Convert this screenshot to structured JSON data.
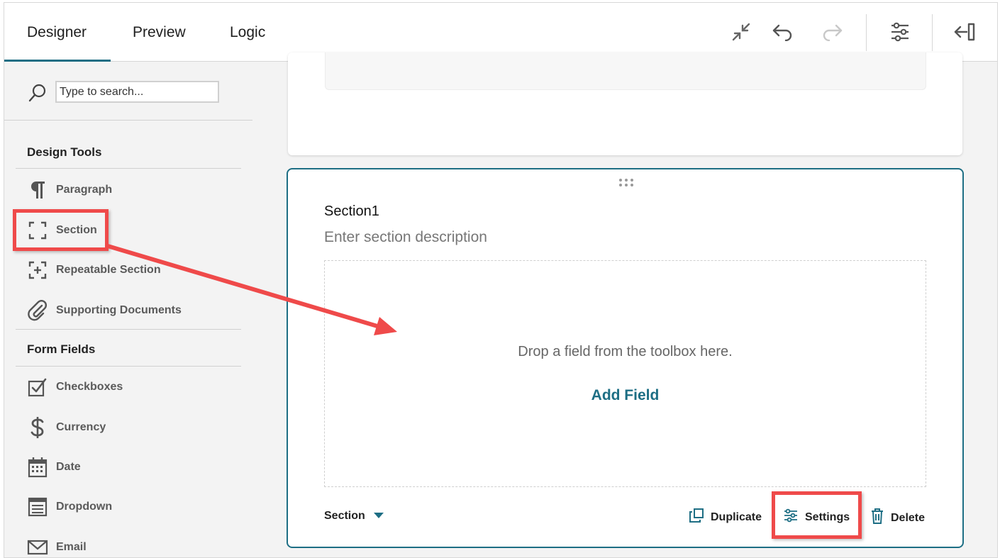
{
  "tabs": [
    {
      "label": "Designer",
      "active": true
    },
    {
      "label": "Preview",
      "active": false
    },
    {
      "label": "Logic",
      "active": false
    }
  ],
  "toolbar": {
    "icons": [
      "collapse-icon",
      "undo-icon",
      "redo-icon",
      "settings-sliders-icon",
      "collapse-panel-icon"
    ],
    "redo_enabled": false
  },
  "search": {
    "placeholder": "Type to search..."
  },
  "design_tools": {
    "title": "Design Tools",
    "items": [
      {
        "label": "Paragraph",
        "icon": "paragraph-icon"
      },
      {
        "label": "Section",
        "icon": "section-icon"
      },
      {
        "label": "Repeatable Section",
        "icon": "repeatable-section-icon"
      },
      {
        "label": "Supporting Documents",
        "icon": "paperclip-icon"
      }
    ]
  },
  "form_fields": {
    "title": "Form Fields",
    "items": [
      {
        "label": "Checkboxes",
        "icon": "checkbox-icon"
      },
      {
        "label": "Currency",
        "icon": "dollar-icon"
      },
      {
        "label": "Date",
        "icon": "calendar-icon"
      },
      {
        "label": "Dropdown",
        "icon": "dropdown-icon"
      },
      {
        "label": "Email",
        "icon": "envelope-icon"
      }
    ]
  },
  "section": {
    "title": "Section1",
    "description": "Enter section description",
    "drop_text": "Drop a field from the toolbox here.",
    "add_field": "Add Field",
    "type_label": "Section",
    "actions": {
      "duplicate": "Duplicate",
      "settings": "Settings",
      "delete": "Delete"
    }
  },
  "colors": {
    "accent": "#1d6e84",
    "highlight": "#ef4a4a"
  }
}
